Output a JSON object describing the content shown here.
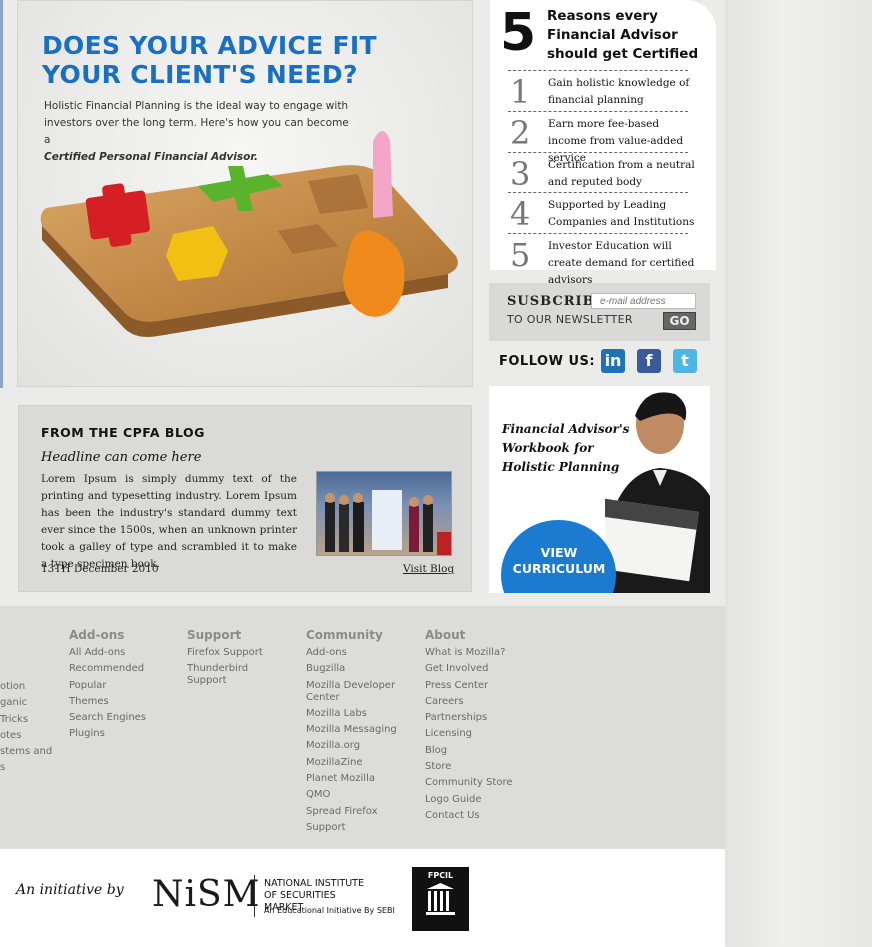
{
  "hero": {
    "title": "DOES YOUR ADVICE FIT YOUR CLIENT'S NEED?",
    "text": "Holistic Financial Planning is the ideal way to engage with investors over the long term. Here's how you can become a",
    "text_bold": "Certified Personal Financial Advisor."
  },
  "reasons": {
    "number": "5",
    "title": "Reasons every Financial Advisor should get Certified",
    "items": [
      {
        "num": "1",
        "text": "Gain holistic knowledge of financial planning"
      },
      {
        "num": "2",
        "text": "Earn more fee-based income from value-added service"
      },
      {
        "num": "3",
        "text": "Certification from a neutral and reputed body"
      },
      {
        "num": "4",
        "text": "Supported by Leading Companies and Institutions"
      },
      {
        "num": "5",
        "text": "Investor Education will create demand for certified advisors"
      }
    ]
  },
  "subscribe": {
    "label": "SUSBCRIBE",
    "sublabel": "TO OUR NEWSLETTER",
    "placeholder": "e-mail address",
    "button": "GO"
  },
  "follow": {
    "label": "FOLLOW US:",
    "linkedin": "in",
    "facebook": "f",
    "twitter": "t",
    "colors": {
      "linkedin": "#1f72b5",
      "facebook": "#3b5a98",
      "twitter": "#4eb6e3"
    }
  },
  "blog": {
    "heading": "FROM THE CPFA BLOG",
    "headline": "Headline can come here",
    "body": "Lorem Ipsum is simply dummy text of the printing and typesetting industry. Lorem Ipsum has been the industry's standard dummy text ever since the 1500s, when an unknown printer took a galley of type and scrambled it to make a type specimen book.",
    "date": "13TH December 2010",
    "link": "Visit Blog"
  },
  "workbook": {
    "title": "Financial Advisor's Workbook for Holistic Planning",
    "cta": "VIEW CURRICULUM"
  },
  "footer": {
    "left_fragments": [
      "otion",
      "ganic",
      "",
      "Tricks",
      "otes",
      "stems and",
      "s"
    ],
    "columns": [
      {
        "heading": "Add-ons",
        "links": [
          "All Add-ons",
          "Recommended",
          "Popular",
          "Themes",
          "Search Engines",
          "Plugins"
        ]
      },
      {
        "heading": "Support",
        "links": [
          "Firefox Support",
          "Thunderbird Support"
        ]
      },
      {
        "heading": "Community",
        "links": [
          "Add-ons",
          "Bugzilla",
          "Mozilla Developer Center",
          "Mozilla Labs",
          "Mozilla Messaging",
          "Mozilla.org",
          "MozillaZine",
          "Planet Mozilla",
          "QMO",
          "Spread Firefox",
          "Support"
        ]
      },
      {
        "heading": "About",
        "links": [
          "What is Mozilla?",
          "Get Involved",
          "Press Center",
          "Careers",
          "Partnerships",
          "Licensing",
          "Blog",
          "Store",
          "Community Store",
          "Logo Guide",
          "Contact Us"
        ]
      }
    ]
  },
  "bottom": {
    "initiative": "An initiative by",
    "nism_logo": "NiSM",
    "nism_name": "NATIONAL INSTITUTE OF SECURITIES MARKET",
    "nism_sub": "An Educational Initiative By SEBI",
    "fpcil": "FPCIL"
  }
}
